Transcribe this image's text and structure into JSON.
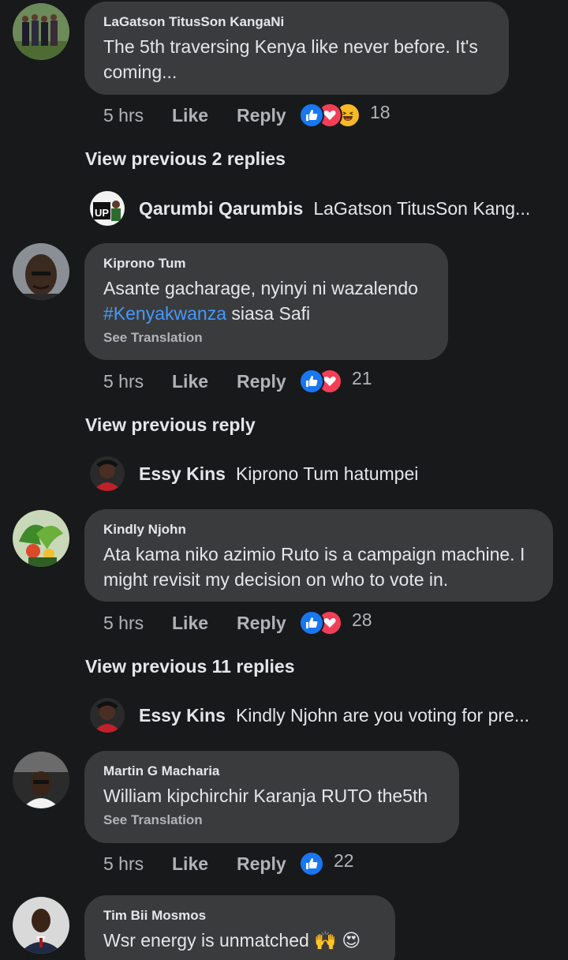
{
  "comments": [
    {
      "author": "LaGatson TitusSon KangaNi",
      "text": "The 5th traversing Kenya like never before. It's coming...",
      "time": "5 hrs",
      "like_label": "Like",
      "reply_label": "Reply",
      "reactions": [
        "like",
        "love",
        "haha"
      ],
      "reaction_count": "18",
      "view_previous": "View previous 2 replies",
      "reply_preview": {
        "author": "Qarumbi Qarumbis",
        "text": "LaGatson TitusSon Kang..."
      }
    },
    {
      "author": "Kiprono Tum",
      "text_before": "Asante gacharage, nyinyi ni wazalendo ",
      "hashtag": "#Kenyakwanza",
      "text_after": " siasa Safi",
      "see_translation": "See Translation",
      "time": "5 hrs",
      "like_label": "Like",
      "reply_label": "Reply",
      "reactions": [
        "like",
        "love"
      ],
      "reaction_count": "21",
      "view_previous": "View previous reply",
      "reply_preview": {
        "author": "Essy Kins",
        "text": "Kiprono Tum hatumpei"
      }
    },
    {
      "author": "Kindly Njohn",
      "text": "Ata kama niko azimio Ruto is a campaign machine. I might revisit my decision on who to vote in.",
      "time": "5 hrs",
      "like_label": "Like",
      "reply_label": "Reply",
      "reactions": [
        "like",
        "love"
      ],
      "reaction_count": "28",
      "view_previous": "View previous 11 replies",
      "reply_preview": {
        "author": "Essy Kins",
        "text": "Kindly Njohn are you voting for pre..."
      }
    },
    {
      "author": "Martin G Macharia",
      "text": "William kipchirchir Karanja RUTO the5th",
      "see_translation": "See Translation",
      "time": "5 hrs",
      "like_label": "Like",
      "reply_label": "Reply",
      "reactions": [
        "like"
      ],
      "reaction_count": "22"
    },
    {
      "author": "Tim Bii Mosmos",
      "text": "Wsr energy is unmatched 🙌 😍"
    }
  ],
  "colors": {
    "background": "#18191a",
    "bubble": "#3a3b3c",
    "text": "#e4e6eb",
    "secondary_text": "#b0b3b8",
    "hashtag": "#4599ff",
    "like_blue": "#1877f2",
    "love_red": "#f33e58",
    "haha_yellow": "#f7b928"
  }
}
